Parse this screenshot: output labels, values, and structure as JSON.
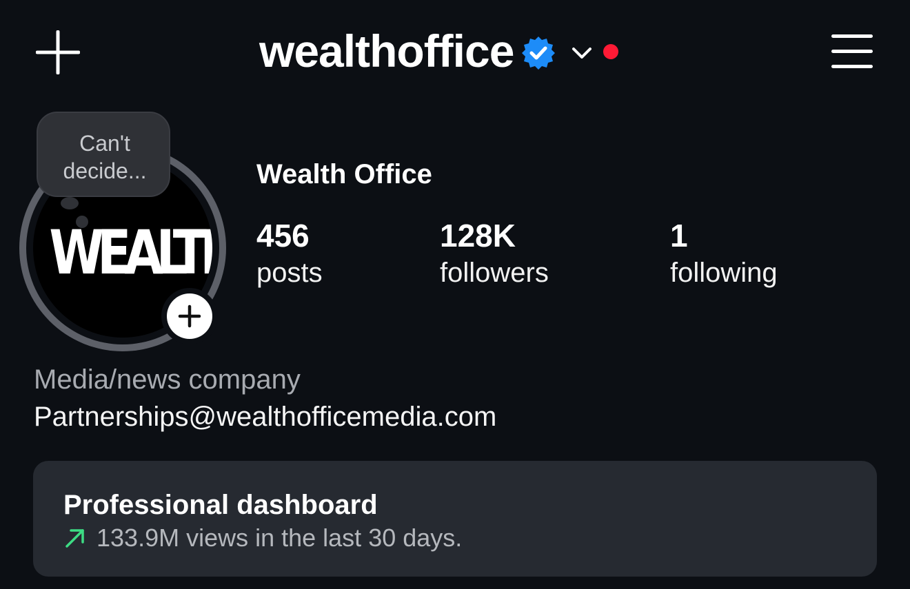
{
  "header": {
    "username": "wealthoffice",
    "add_icon": "plus-icon",
    "verified_icon": "verified-badge-icon",
    "chevron_icon": "chevron-down-icon",
    "menu_icon": "hamburger-menu-icon",
    "verified_color": "#1d8cf8",
    "notification_dot_color": "#ff1a35"
  },
  "profile": {
    "avatar_text": "WEALTH",
    "note": "Can't\ndecide...",
    "display_name": "Wealth Office",
    "category": "Media/news company",
    "email": "Partnerships@wealthofficemedia.com"
  },
  "stats": [
    {
      "value": "456",
      "label": "posts"
    },
    {
      "value": "128K",
      "label": "followers"
    },
    {
      "value": "1",
      "label": "following"
    }
  ],
  "dashboard": {
    "title": "Professional dashboard",
    "subtitle": "133.9M views in the last 30 days.",
    "trend_icon": "trend-up-arrow-icon",
    "trend_color": "#3ddc84"
  }
}
